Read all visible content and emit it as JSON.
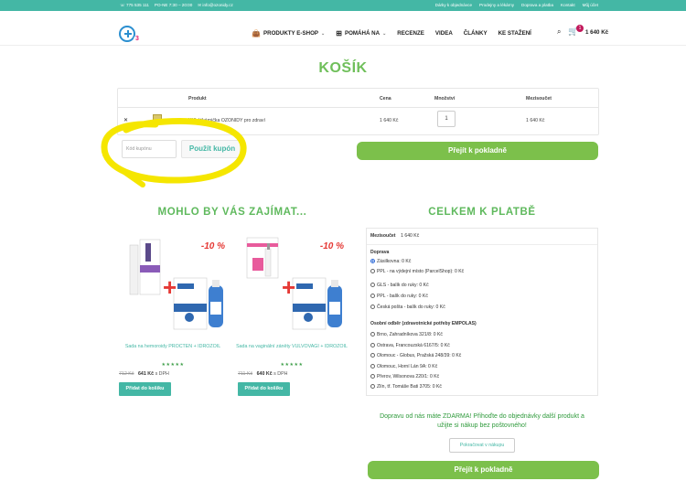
{
  "topbar": {
    "phone": "775 535 111",
    "hours": "PO-NE 7:30 – 20:00",
    "email": "info@ozonidy.cz",
    "links": [
      "Dárky k objednávce",
      "Prodejny a lékárny",
      "Doprava a platba",
      "Kontakt",
      "Můj účet"
    ]
  },
  "header": {
    "logo_suffix": "3",
    "nav": [
      {
        "label": "PRODUKTY E-SHOP",
        "icon": "shopping-bag-icon",
        "chevron": true
      },
      {
        "label": "POMÁHÁ NA",
        "icon": "first-aid-icon",
        "chevron": true
      },
      {
        "label": "RECENZE"
      },
      {
        "label": "VIDEA"
      },
      {
        "label": "ČLÁNKY"
      },
      {
        "label": "KE STAŽENÍ"
      }
    ],
    "cart_count": "1",
    "cart_total": "1 640 Kč"
  },
  "page_title": "KOŠÍK",
  "cart": {
    "headers": {
      "product": "Produkt",
      "price": "Cena",
      "qty": "Množství",
      "subtotal": "Mezisoučet"
    },
    "item": {
      "name": "XXL lékárnička OZONIDY pro zdraví",
      "price": "1 640 Kč",
      "qty": "1",
      "subtotal": "1 640 Kč"
    },
    "coupon_placeholder": "Kód kupónu",
    "coupon_button": "Použít kupón",
    "checkout_button": "Přejít k pokladně"
  },
  "recommend": {
    "title": "MOHLO BY VÁS ZAJÍMAT...",
    "products": [
      {
        "discount": "-10 %",
        "title": "Sada na hemoroidy PROCTEN + IDROZOIL",
        "stars": "★★★★★",
        "old_price": "712 Kč",
        "new_price": "641 Kč",
        "vat": "s DPH",
        "button": "Přidat do košíku"
      },
      {
        "discount": "-10 %",
        "title": "Sada na vaginální záněty VULVOVAGI + IDROZOIL",
        "stars": "★★★★★",
        "old_price": "711 Kč",
        "new_price": "640 Kč",
        "vat": "s DPH",
        "button": "Přidat do košíku"
      }
    ]
  },
  "totals": {
    "title": "CELKEM K PLATBĚ",
    "subtotal_label": "Mezisoučet",
    "subtotal_value": "1 640 Kč",
    "shipping_label": "Doprava",
    "shipping_options": [
      {
        "label": "Zásilkovna: 0 Kč",
        "checked": true
      },
      {
        "label": "PPL - na výdejní místo (ParcelShop): 0 Kč",
        "checked": false
      },
      {
        "label": "GLS - balík do ruky: 0 Kč",
        "checked": false
      },
      {
        "label": "PPL - balík do ruky: 0 Kč",
        "checked": false
      },
      {
        "label": "Česká pošta - balík do ruky: 0 Kč",
        "checked": false
      }
    ],
    "pickup_label": "Osobní odběr (zdravotnické potřeby EMPOLAS)",
    "pickup_options": [
      "Brno, Zahradníkova 321/8: 0 Kč",
      "Ostrava, Francouzská 6167/5: 0 Kč",
      "Olomouc - Globus, Pražská 248/39: 0 Kč",
      "Olomouc, Horní Lán 9A: 0 Kč",
      "Přerov, Wilsonova 220/1: 0 Kč",
      "Zlín, tř. Tomáše Bati 3705: 0 Kč"
    ],
    "free_note_1": "Dopravu od nás máte ZDARMA! Přihoďte do objednávky další produkt a",
    "free_note_2": "užijte si nákup bez poštovného!",
    "continue_button": "Pokračovat v nákupu",
    "checkout_button": "Přejít k pokladně"
  },
  "colors": {
    "teal": "#44b7a5",
    "green": "#7cc04b",
    "title_green": "#6fbf5a",
    "red": "#e53935",
    "highlight": "#f5e600"
  }
}
